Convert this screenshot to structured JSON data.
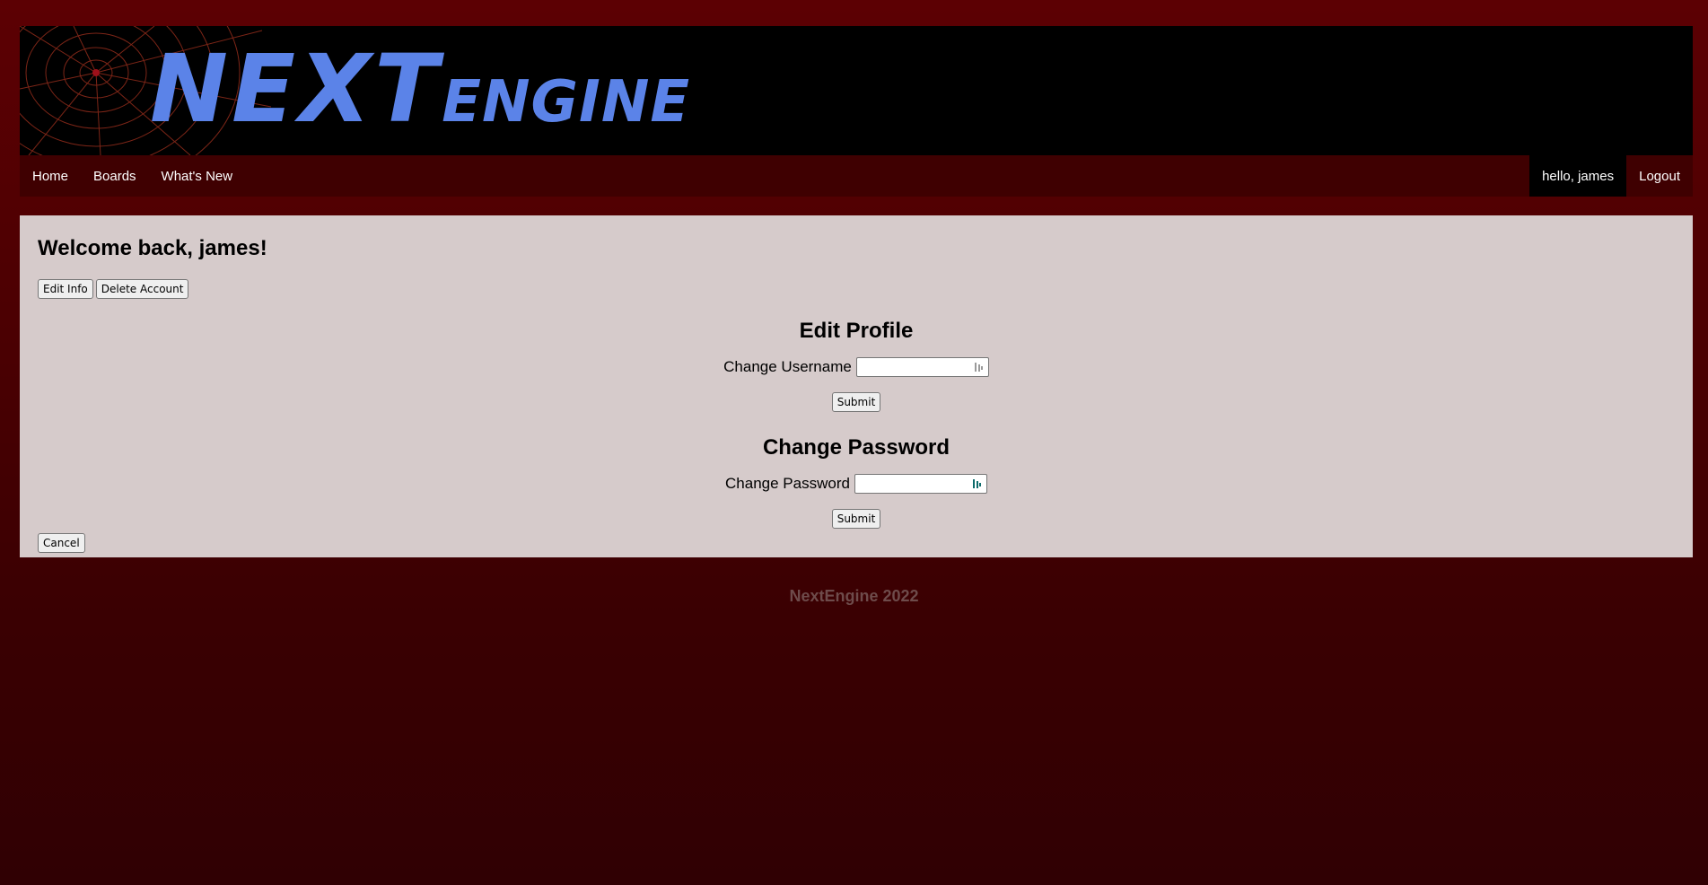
{
  "header": {
    "logo_main": "NEXT",
    "logo_sub": "ENGINE"
  },
  "nav": {
    "items": [
      {
        "label": "Home"
      },
      {
        "label": "Boards"
      },
      {
        "label": "What's New"
      }
    ],
    "hello": "hello, james",
    "logout": "Logout"
  },
  "main": {
    "welcome": "Welcome back, james!",
    "edit_info": "Edit Info",
    "delete_account": "Delete Account",
    "edit_profile": {
      "title": "Edit Profile",
      "label": "Change Username",
      "value": "",
      "submit": "Submit"
    },
    "change_password": {
      "title": "Change Password",
      "label": "Change Password",
      "value": "",
      "submit": "Submit"
    },
    "cancel": "Cancel"
  },
  "footer": {
    "text": "NextEngine 2022"
  },
  "colors": {
    "background": "#4a0002",
    "banner": "#000000",
    "navbar": "#3f0001",
    "content": "#d6cbcb",
    "logo": "#5b83e8",
    "footer_text": "#6e4b4b"
  }
}
